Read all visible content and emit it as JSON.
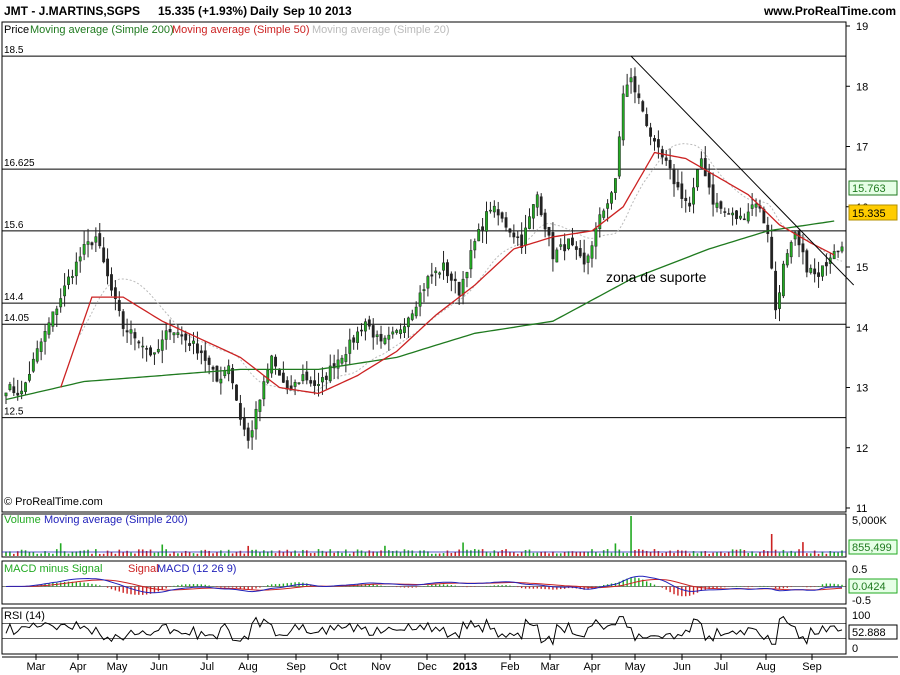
{
  "header": {
    "title": "JMT - J.MARTINS,SGPS",
    "price": "15.335 (+1.93%)",
    "period": "Daily",
    "date": "Sep 10 2013",
    "site": "www.ProRealTime.com"
  },
  "legend": {
    "price": "Price",
    "ma200": "Moving average (Simple 200)",
    "ma50": "Moving average (Simple 50)",
    "ma20": "Moving average (Simple 20)"
  },
  "colors": {
    "bull": "#22aa22",
    "bear": "#222222",
    "ma200": "#1f7a1f",
    "ma50": "#cc2222",
    "ma20": "#bbbbbb",
    "volume": "#2a8a2a",
    "macd_line": "#2222bb",
    "signal_line": "#cc2222",
    "hist_pos": "#22aa22",
    "hist_neg": "#cc2222",
    "rsi_line": "#000000",
    "badge_price": "#ffcc00",
    "badge_ma200": "#e6ffe6"
  },
  "copyright": "© ProRealTime.com",
  "annotation": "zona de suporte",
  "levels": [
    {
      "value": 18.5,
      "label": "18.5"
    },
    {
      "value": 16.625,
      "label": "16.625"
    },
    {
      "value": 15.6,
      "label": "15.6"
    },
    {
      "value": 14.4,
      "label": "14.4"
    },
    {
      "value": 14.05,
      "label": "14.05"
    },
    {
      "value": 12.5,
      "label": "12.5"
    }
  ],
  "price_axis": {
    "ticks": [
      "19",
      "18",
      "17",
      "16",
      "15",
      "14",
      "13",
      "12",
      "11"
    ]
  },
  "badges": {
    "ma200": "15.763",
    "price": "15.335"
  },
  "volume_panel": {
    "label_volume": "Volume",
    "label_ma": "Moving average (Simple 200)",
    "axis_top": "5,000K",
    "badge": "855,499"
  },
  "macd_panel": {
    "label_hist": "MACD minus Signal",
    "label_signal": "Signal",
    "label_macd": "MACD (12 26 9)",
    "ticks": [
      "0.5",
      "-0.5"
    ],
    "badge": "0.0424"
  },
  "rsi_panel": {
    "label": "RSI (14)",
    "ticks": [
      "100",
      "0"
    ],
    "badge": "52.888"
  },
  "chart_data": {
    "type": "candlestick",
    "x_axis_labels": [
      "Mar",
      "Apr",
      "May",
      "Jun",
      "Jul",
      "Aug",
      "Sep",
      "Oct",
      "Nov",
      "Dec",
      "2013",
      "Feb",
      "Mar",
      "Apr",
      "May",
      "Jun",
      "Jul",
      "Aug",
      "Sep"
    ],
    "ylim": [
      11,
      19
    ],
    "close_points": [
      [
        0,
        13.0
      ],
      [
        4,
        12.9
      ],
      [
        8,
        13.6
      ],
      [
        12,
        14.2
      ],
      [
        16,
        14.8
      ],
      [
        20,
        15.3
      ],
      [
        23,
        15.5
      ],
      [
        27,
        14.6
      ],
      [
        30,
        14.0
      ],
      [
        34,
        13.8
      ],
      [
        38,
        13.5
      ],
      [
        42,
        14.0
      ],
      [
        46,
        13.8
      ],
      [
        50,
        13.6
      ],
      [
        54,
        13.1
      ],
      [
        57,
        13.4
      ],
      [
        60,
        12.5
      ],
      [
        62,
        12.1
      ],
      [
        65,
        12.8
      ],
      [
        68,
        13.5
      ],
      [
        72,
        12.9
      ],
      [
        76,
        13.2
      ],
      [
        80,
        13.0
      ],
      [
        84,
        13.4
      ],
      [
        88,
        13.7
      ],
      [
        92,
        14.1
      ],
      [
        96,
        13.7
      ],
      [
        100,
        13.9
      ],
      [
        104,
        14.3
      ],
      [
        108,
        14.8
      ],
      [
        112,
        15.0
      ],
      [
        116,
        14.6
      ],
      [
        120,
        15.4
      ],
      [
        124,
        16.0
      ],
      [
        128,
        15.7
      ],
      [
        132,
        15.4
      ],
      [
        136,
        16.2
      ],
      [
        140,
        15.2
      ],
      [
        144,
        15.4
      ],
      [
        148,
        15.0
      ],
      [
        152,
        15.8
      ],
      [
        156,
        16.4
      ],
      [
        158,
        17.9
      ],
      [
        160,
        18.1
      ],
      [
        163,
        17.6
      ],
      [
        166,
        17.0
      ],
      [
        169,
        16.7
      ],
      [
        172,
        16.3
      ],
      [
        175,
        16.0
      ],
      [
        178,
        16.8
      ],
      [
        181,
        16.1
      ],
      [
        184,
        15.9
      ],
      [
        188,
        15.8
      ],
      [
        192,
        16.1
      ],
      [
        195,
        15.6
      ],
      [
        197,
        14.3
      ],
      [
        199,
        15.0
      ],
      [
        202,
        15.5
      ],
      [
        205,
        15.0
      ],
      [
        208,
        14.8
      ],
      [
        210,
        15.1
      ],
      [
        212,
        15.335
      ]
    ],
    "ma50_points": [
      [
        14,
        13.0
      ],
      [
        22,
        14.5
      ],
      [
        30,
        14.5
      ],
      [
        40,
        14.1
      ],
      [
        50,
        13.8
      ],
      [
        60,
        13.5
      ],
      [
        70,
        13.0
      ],
      [
        80,
        12.9
      ],
      [
        90,
        13.2
      ],
      [
        100,
        13.6
      ],
      [
        110,
        14.2
      ],
      [
        120,
        14.7
      ],
      [
        130,
        15.3
      ],
      [
        140,
        15.5
      ],
      [
        150,
        15.6
      ],
      [
        158,
        16.0
      ],
      [
        166,
        16.9
      ],
      [
        174,
        16.8
      ],
      [
        182,
        16.5
      ],
      [
        190,
        16.2
      ],
      [
        198,
        15.7
      ],
      [
        206,
        15.4
      ],
      [
        212,
        15.2
      ]
    ],
    "ma200_points": [
      [
        0,
        12.8
      ],
      [
        20,
        13.1
      ],
      [
        40,
        13.2
      ],
      [
        60,
        13.3
      ],
      [
        80,
        13.3
      ],
      [
        100,
        13.5
      ],
      [
        120,
        13.9
      ],
      [
        140,
        14.1
      ],
      [
        160,
        14.8
      ],
      [
        180,
        15.3
      ],
      [
        195,
        15.6
      ],
      [
        212,
        15.763
      ]
    ],
    "trendline": [
      [
        160,
        18.5
      ],
      [
        217,
        14.7
      ]
    ],
    "last_close": 15.335,
    "ma200_last": 15.763
  }
}
